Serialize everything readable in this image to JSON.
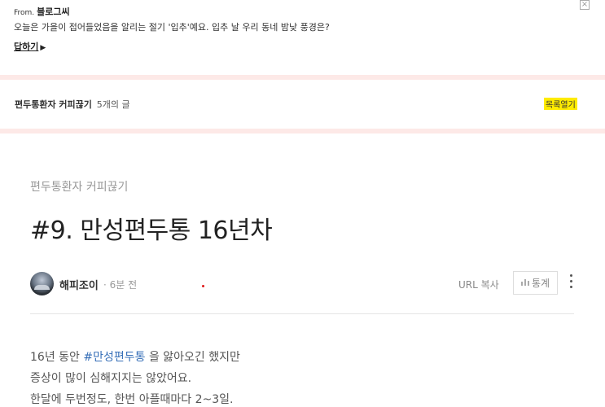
{
  "notice": {
    "from_prefix": "From.",
    "from_name": "블로그씨",
    "message": "오늘은 가을이 접어들었음을 알리는 절기 '입추'예요. 입추 날 우리 동네 밤낮 풍경은?",
    "reply_label": "답하기",
    "reply_arrow": "▶",
    "close_glyph": "×"
  },
  "series": {
    "name": "편두통환자 커피끊기",
    "count": "5개의 글",
    "list_open": "목록열기"
  },
  "post": {
    "category": "편두통환자 커피끊기",
    "title": "#9. 만성편두통 16년차",
    "author": "해피조이",
    "time": "· 6분 전",
    "url_copy": "URL 복사",
    "stats_icon": "bar-chart-icon",
    "stats_label": "통계",
    "body": {
      "line1_pre": "16년 동안 ",
      "line1_tag": "#만성편두통",
      "line1_post": " 을 앓아오긴 했지만",
      "line2": "증상이 많이 심해지지는 않았어요.",
      "line3": "한달에 두번정도, 한번 아플때마다 2~3일."
    }
  },
  "colors": {
    "band": "#fde9e7",
    "highlight": "#ffeb00",
    "tag": "#3870b8"
  }
}
